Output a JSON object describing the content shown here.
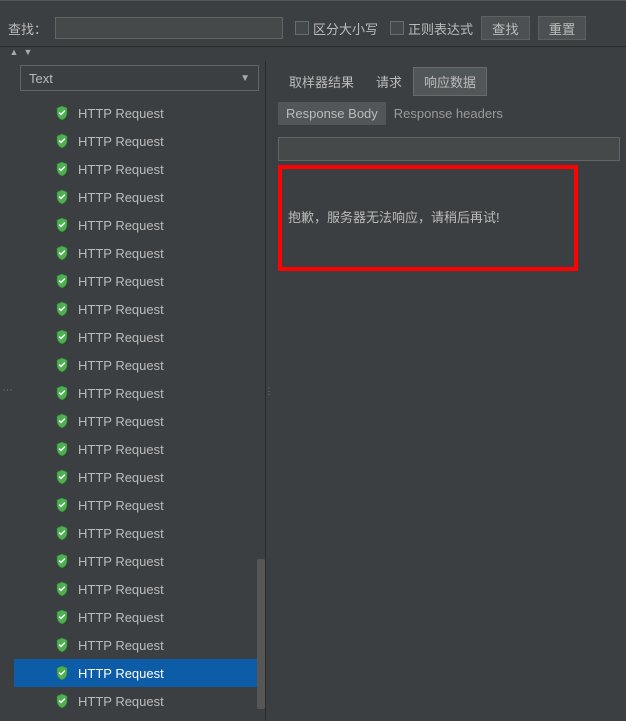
{
  "search": {
    "label": "查找：",
    "caseSensitive": "区分大小写",
    "regex": "正则表达式",
    "findBtn": "查找",
    "resetBtn": "重置"
  },
  "leftPanel": {
    "dropdownValue": "Text",
    "treeItems": [
      {
        "label": "HTTP Request",
        "selected": false
      },
      {
        "label": "HTTP Request",
        "selected": false
      },
      {
        "label": "HTTP Request",
        "selected": false
      },
      {
        "label": "HTTP Request",
        "selected": false
      },
      {
        "label": "HTTP Request",
        "selected": false
      },
      {
        "label": "HTTP Request",
        "selected": false
      },
      {
        "label": "HTTP Request",
        "selected": false
      },
      {
        "label": "HTTP Request",
        "selected": false
      },
      {
        "label": "HTTP Request",
        "selected": false
      },
      {
        "label": "HTTP Request",
        "selected": false
      },
      {
        "label": "HTTP Request",
        "selected": false
      },
      {
        "label": "HTTP Request",
        "selected": false
      },
      {
        "label": "HTTP Request",
        "selected": false
      },
      {
        "label": "HTTP Request",
        "selected": false
      },
      {
        "label": "HTTP Request",
        "selected": false
      },
      {
        "label": "HTTP Request",
        "selected": false
      },
      {
        "label": "HTTP Request",
        "selected": false
      },
      {
        "label": "HTTP Request",
        "selected": false
      },
      {
        "label": "HTTP Request",
        "selected": false
      },
      {
        "label": "HTTP Request",
        "selected": false
      },
      {
        "label": "HTTP Request",
        "selected": true
      },
      {
        "label": "HTTP Request",
        "selected": false
      }
    ]
  },
  "rightPanel": {
    "tabs": {
      "samplerResult": "取样器结果",
      "request": "请求",
      "responseData": "响应数据"
    },
    "subTabs": {
      "responseBody": "Response Body",
      "responseHeaders": "Response headers"
    },
    "responseText": "抱歉，服务器无法响应，请稍后再试!"
  }
}
